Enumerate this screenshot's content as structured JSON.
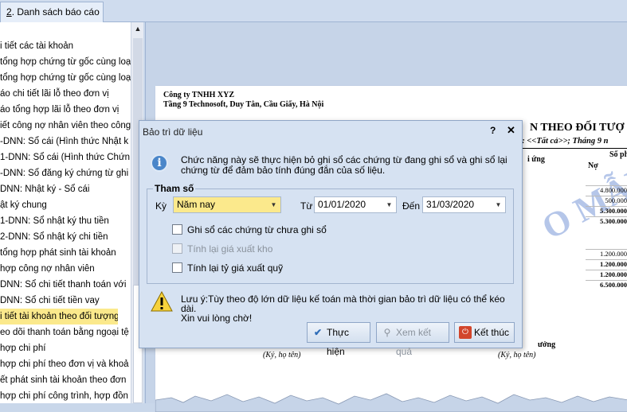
{
  "tabs": [
    {
      "number": "2",
      "label": ". Danh sách báo cáo"
    }
  ],
  "left_list": {
    "items": [
      "i tiết các tài khoản",
      "tổng hợp chứng từ gốc cùng loạ",
      "tổng hợp chứng từ gốc cùng loạ",
      "áo chi tiết lãi lỗ theo đơn vị",
      "áo tổng hợp lãi lỗ theo đơn vị",
      "iết công nợ nhân viên theo công",
      "-DNN: Sổ cái (Hình thức Nhật k",
      "1-DNN: Sổ cái (Hình thức Chứn",
      "-DNN: Sổ đăng ký chứng từ ghi",
      "DNN: Nhật ký - Sổ cái",
      "ật ký chung",
      "1-DNN: Sổ nhật ký thu tiền",
      "2-DNN: Sổ nhật ký chi tiền",
      "tổng hợp phát sinh tài khoản",
      "hợp công nợ nhân viên",
      "DNN: Sổ chi tiết thanh toán với",
      "DNN: Sổ chi tiết tiền vay",
      "i tiết tài khoản theo đối tượng",
      "eo dõi thanh toán bằng ngoại tệ",
      "hợp chi phí",
      "hợp chi phí theo đơn vị và khoả",
      "ết phát sinh tài khoản theo đơn",
      "hợp chi phí công trình, hợp đồn"
    ],
    "selected_index": 17
  },
  "report": {
    "company": "Công ty TNHH XYZ",
    "address": "Tầng 9 Technosoft, Duy Tân, Cầu Giấy, Hà Nội",
    "title": "N THEO ĐỐI TƯỢ",
    "subtitle": "g: <<Tất cả>>; Tháng 9 n",
    "col_doi_tuong": "i ứng",
    "col_so_phat": "Số phát",
    "col_no": "Nợ",
    "watermark": "O MẪU",
    "amounts_top": [
      "4.800.000",
      "500.000",
      "5.300.000",
      "5.300.000"
    ],
    "amounts_bottom": [
      "1.200.000",
      "1.200.000",
      "1.200.000",
      "6.500.000"
    ],
    "signature_title": "ưởng",
    "sign_left": "(Ký, họ tên)",
    "sign_right": "(Ký, họ tên)"
  },
  "dialog": {
    "title": "Bảo trì dữ liệu",
    "help": "?",
    "close": "✕",
    "info": "Chức năng này sẽ thực hiện bỏ ghi sổ các chứng từ đang ghi sổ và ghi sổ lại chứng từ để đảm bảo tính đúng đắn của số liệu.",
    "group_label": "Tham số",
    "ky_label": "Kỳ",
    "ky_value": "Năm nay",
    "tu_label": "Từ",
    "tu_value": "01/01/2020",
    "den_label": "Đến",
    "den_value": "31/03/2020",
    "chk_ghi_so": "Ghi sổ các chứng từ chưa ghi sổ",
    "chk_gia_xuat_kho": "Tính lại giá xuất kho",
    "chk_ty_gia": "Tính lại tỷ giá xuất quỹ",
    "warning_line1": "Lưu ý:Tùy theo độ lớn dữ liệu kế toán mà thời gian bảo trì dữ liệu có thể kéo dài.",
    "warning_line2": "Xin vui lòng chờ!",
    "btn_thuc_hien": "Thực hiện",
    "btn_xem_ket_qua": "Xem kết quả",
    "btn_ket_thuc": "Kết thúc"
  }
}
